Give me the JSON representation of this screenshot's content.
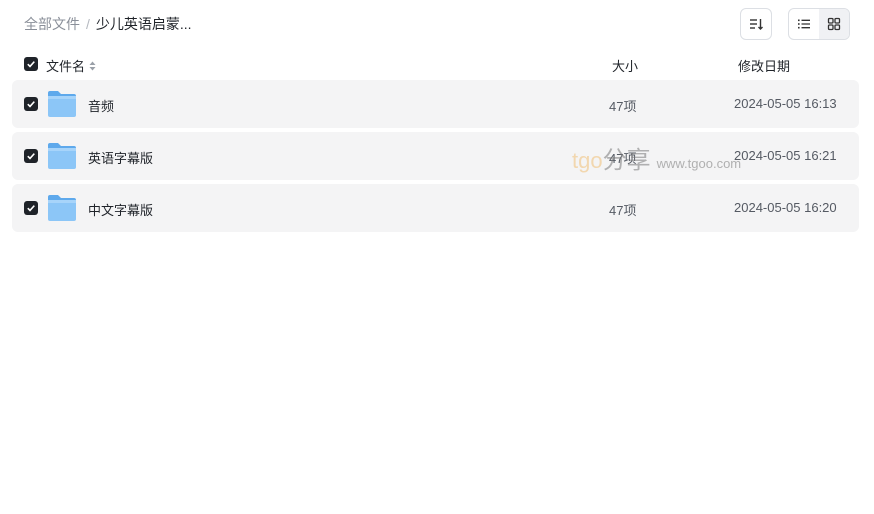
{
  "breadcrumb": {
    "root": "全部文件",
    "separator": "/",
    "current": "少儿英语启蒙..."
  },
  "toolbar": {
    "sort_icon": "sort-icon",
    "list_view_icon": "list-view-icon",
    "grid_view_icon": "grid-view-icon"
  },
  "table": {
    "headers": {
      "name": "文件名",
      "size": "大小",
      "date": "修改日期"
    },
    "rows": [
      {
        "name": "音频",
        "size": "47项",
        "date": "2024-05-05 16:13"
      },
      {
        "name": "英语字幕版",
        "size": "47项",
        "date": "2024-05-05 16:21"
      },
      {
        "name": "中文字幕版",
        "size": "47项",
        "date": "2024-05-05 16:20"
      }
    ]
  },
  "watermark": {
    "part_a": "tgo",
    "part_b": "分享",
    "part_c": "www.tgoo.com"
  },
  "colors": {
    "accent": "#1f2329",
    "row_bg": "#f4f4f5",
    "folder": "#6db3f2"
  }
}
